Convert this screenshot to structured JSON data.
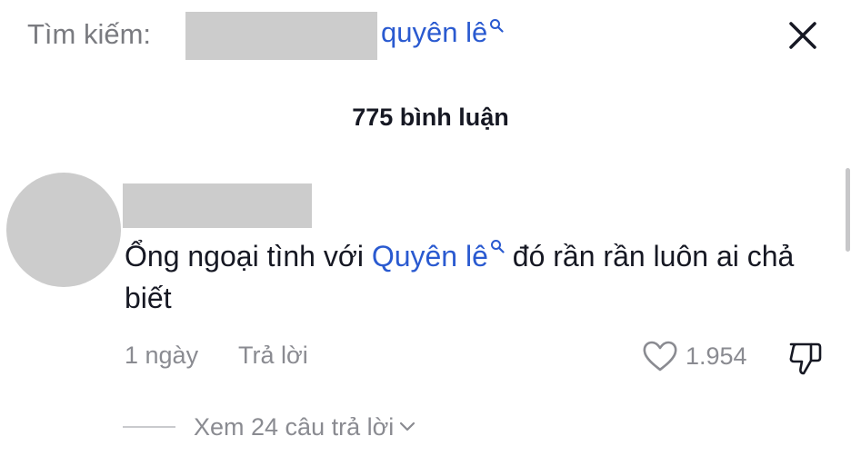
{
  "search": {
    "label": "Tìm kiếm:",
    "term": "quyên lê"
  },
  "comments_header": {
    "count_label": "775 bình luận"
  },
  "comment": {
    "text_before": "Ổng ngoại tình với ",
    "mention": "Quyên lê",
    "text_after": " đó rần rần luôn ai chả biết",
    "time": "1 ngày",
    "reply_label": "Trả lời",
    "likes": "1.954",
    "view_replies_label": "Xem 24 câu trả lời"
  },
  "icons": {
    "close": "close-icon",
    "search": "search-icon",
    "like": "heart-icon",
    "dislike": "thumbs-down-icon",
    "expand": "chevron-down-icon"
  },
  "colors": {
    "link": "#2a5ad0",
    "text": "#161823",
    "muted": "#8a8b91",
    "redacted": "#cccccc"
  }
}
